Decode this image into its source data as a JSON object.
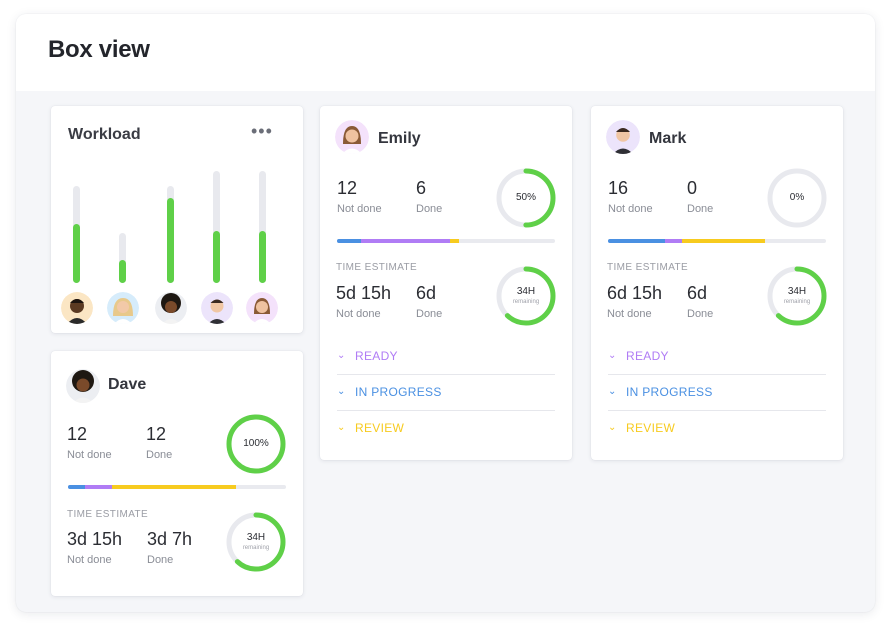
{
  "page": {
    "title": "Box view"
  },
  "colors": {
    "green": "#5fd048",
    "blue": "#4a90e2",
    "purple": "#b07cf5",
    "yellow": "#f7cb1f",
    "track": "#e8e9ee"
  },
  "workload": {
    "title": "Workload",
    "more_icon": "more-horizontal-icon",
    "more_glyph": "•••",
    "bars": [
      {
        "member": "member-1",
        "fill": 0.61
      },
      {
        "member": "member-2",
        "fill": 0.45
      },
      {
        "member": "member-3",
        "fill": 0.88
      },
      {
        "member": "member-4",
        "fill": 0.46
      },
      {
        "member": "member-5",
        "fill": 0.46
      }
    ]
  },
  "cards": {
    "emily": {
      "name": "Emily",
      "not_done": "12",
      "not_done_label": "Not done",
      "done": "6",
      "done_label": "Done",
      "percent": "50%",
      "percent_value": 0.5,
      "progress": [
        {
          "color": "#4a90e2",
          "fraction": 0.11
        },
        {
          "color": "#b07cf5",
          "fraction": 0.41
        },
        {
          "color": "#f7cb1f",
          "fraction": 0.04
        }
      ],
      "time_label": "TIME ESTIMATE",
      "time_not_done": "5d 15h",
      "time_not_done_label": "Not done",
      "time_done": "6d",
      "time_done_label": "Done",
      "remaining": "34H",
      "remaining_label": "remaining",
      "remaining_value": 0.62,
      "statuses": [
        {
          "label": "READY",
          "color": "#b07cf5"
        },
        {
          "label": "IN PROGRESS",
          "color": "#4a90e2"
        },
        {
          "label": "REVIEW",
          "color": "#f7cb1f"
        }
      ]
    },
    "mark": {
      "name": "Mark",
      "not_done": "16",
      "not_done_label": "Not done",
      "done": "0",
      "done_label": "Done",
      "percent": "0%",
      "percent_value": 0,
      "progress": [
        {
          "color": "#4a90e2",
          "fraction": 0.26
        },
        {
          "color": "#b07cf5",
          "fraction": 0.08
        },
        {
          "color": "#f7cb1f",
          "fraction": 0.38
        }
      ],
      "time_label": "TIME ESTIMATE",
      "time_not_done": "6d 15h",
      "time_not_done_label": "Not done",
      "time_done": "6d",
      "time_done_label": "Done",
      "remaining": "34H",
      "remaining_label": "remaining",
      "remaining_value": 0.62,
      "statuses": [
        {
          "label": "READY",
          "color": "#b07cf5"
        },
        {
          "label": "IN PROGRESS",
          "color": "#4a90e2"
        },
        {
          "label": "REVIEW",
          "color": "#f7cb1f"
        }
      ]
    },
    "dave": {
      "name": "Dave",
      "not_done": "12",
      "not_done_label": "Not done",
      "done": "12",
      "done_label": "Done",
      "percent": "100%",
      "percent_value": 1,
      "progress": [
        {
          "color": "#4a90e2",
          "fraction": 0.08
        },
        {
          "color": "#b07cf5",
          "fraction": 0.12
        },
        {
          "color": "#f7cb1f",
          "fraction": 0.57
        }
      ],
      "time_label": "TIME ESTIMATE",
      "time_not_done": "3d 15h",
      "time_not_done_label": "Not done",
      "time_done": "3d 7h",
      "time_done_label": "Done",
      "remaining": "34H",
      "remaining_label": "remaining",
      "remaining_value": 0.62
    }
  }
}
